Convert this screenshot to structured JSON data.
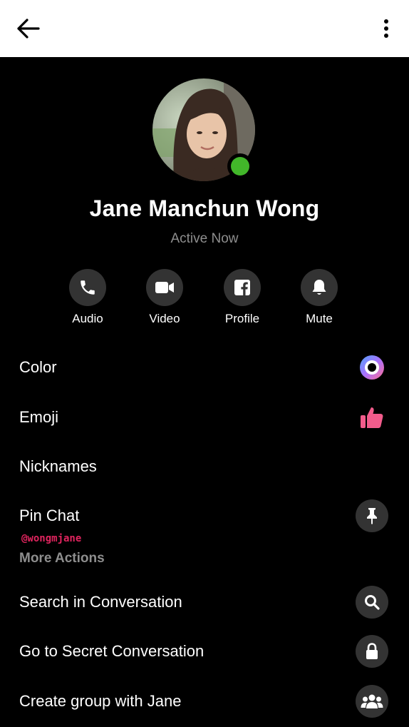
{
  "header": {
    "back_icon": "arrow-left-icon",
    "menu_icon": "more-vertical-icon"
  },
  "profile": {
    "name": "Jane Manchun Wong",
    "status": "Active Now",
    "presence_color": "#42b72a"
  },
  "actions": [
    {
      "label": "Audio",
      "icon": "phone-icon"
    },
    {
      "label": "Video",
      "icon": "video-camera-icon"
    },
    {
      "label": "Profile",
      "icon": "facebook-icon"
    },
    {
      "label": "Mute",
      "icon": "bell-icon"
    }
  ],
  "settings": {
    "color": {
      "label": "Color",
      "icon": "color-gradient-icon"
    },
    "emoji": {
      "label": "Emoji",
      "icon": "thumbs-up-icon",
      "icon_color": "#f25c8c"
    },
    "nicknames": {
      "label": "Nicknames"
    },
    "pin_chat": {
      "label": "Pin Chat",
      "icon": "pin-icon"
    }
  },
  "watermark": "@wongmjane",
  "more_actions": {
    "header": "More Actions",
    "items": [
      {
        "label": "Search in Conversation",
        "icon": "search-icon"
      },
      {
        "label": "Go to Secret Conversation",
        "icon": "lock-icon"
      },
      {
        "label": "Create group with Jane",
        "icon": "group-icon"
      }
    ]
  },
  "colors": {
    "background": "#000000",
    "header_bg": "#ffffff",
    "icon_circle": "#333333",
    "muted_text": "#8e8e8e",
    "watermark": "#e0245e"
  }
}
